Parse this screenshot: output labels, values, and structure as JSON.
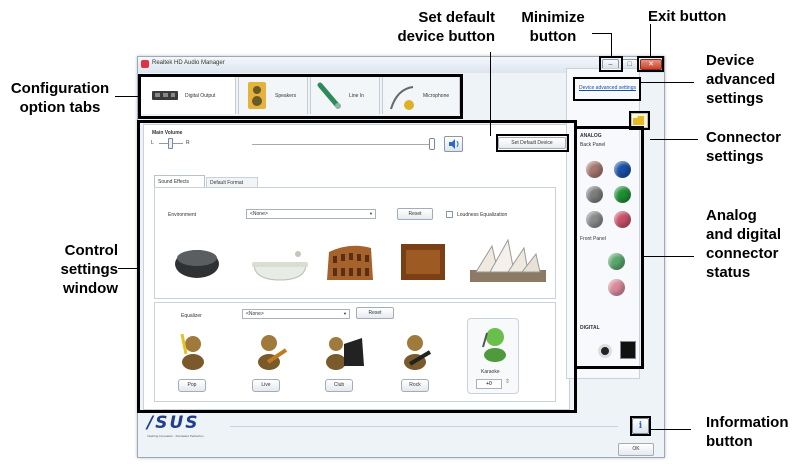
{
  "window": {
    "title": "Realtek HD Audio Manager",
    "minimize_glyph": "–",
    "maximize_glyph": "□",
    "close_glyph": "✕"
  },
  "tabs": [
    {
      "label": "Digital Output",
      "icon": "digital-output-icon",
      "active": true
    },
    {
      "label": "Speakers",
      "icon": "speakers-icon",
      "active": false
    },
    {
      "label": "Line In",
      "icon": "line-in-icon",
      "active": false
    },
    {
      "label": "Microphone",
      "icon": "microphone-icon",
      "active": false
    }
  ],
  "control": {
    "main_volume_label": "Main Volume",
    "balance_left": "L",
    "balance_right": "R",
    "set_default_device": "Set Default Device",
    "subtabs": [
      "Sound Effects",
      "Default Format"
    ],
    "environment_label": "Environment",
    "environment_value": "<None>",
    "reset_label": "Reset",
    "loudness_label": "Loudness Equalization",
    "equalizer_label": "Equalizer",
    "equalizer_value": "<None>",
    "eq_reset_label": "Reset",
    "presets": [
      "Pop",
      "Live",
      "Club",
      "Rock"
    ],
    "karaoke_label": "Karaoke",
    "karaoke_value": "+0"
  },
  "right_panel": {
    "device_advanced_settings": "Device advanced settings",
    "analog_label": "ANALOG",
    "back_panel_label": "Back Panel",
    "front_panel_label": "Front Panel",
    "digital_label": "DIGITAL"
  },
  "back_panel_jacks": [
    "#a5776e",
    "#1a4fa8",
    "#7d7d7d",
    "#1f8f33",
    "#8a8a8a",
    "#c8506a"
  ],
  "front_panel_jacks": [
    "#5aa66b",
    "#d88a9a"
  ],
  "footer": {
    "logo_text": "/SUS",
    "logo_tagline": "Inspiring Innovation · Persistent Perfection",
    "info_glyph": "i",
    "ok_label": "OK"
  },
  "callouts": {
    "config_tabs": "Configuration\noption tabs",
    "set_default": "Set default\ndevice button",
    "minimize": "Minimize\nbutton",
    "exit": "Exit button",
    "device_advanced": "Device\nadvanced\nsettings",
    "connector": "Connector\nsettings",
    "control_window": "Control\nsettings\nwindow",
    "analog_digital": "Analog\nand digital\nconnector\nstatus",
    "information": "Information\nbutton"
  }
}
